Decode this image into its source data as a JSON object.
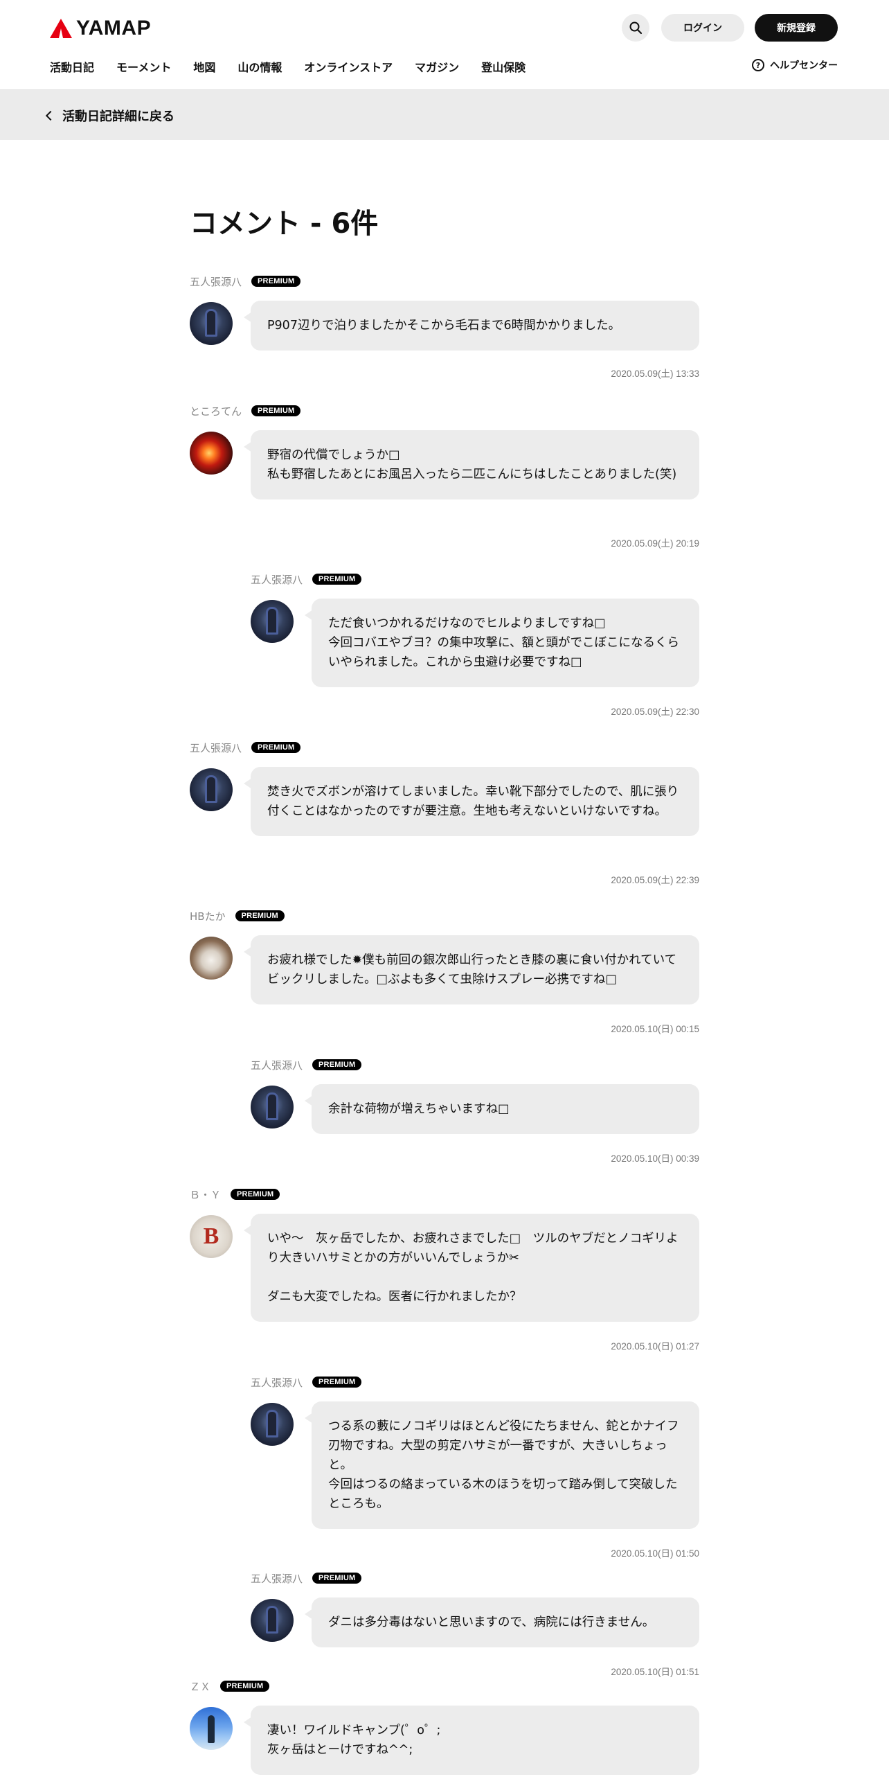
{
  "header": {
    "logo_text": "YAMAP",
    "login_label": "ログイン",
    "signup_label": "新規登録",
    "nav": [
      "活動日記",
      "モーメント",
      "地図",
      "山の情報",
      "オンラインストア",
      "マガジン",
      "登山保険"
    ],
    "help_label": "ヘルプセンター"
  },
  "backbar": {
    "label": "活動日記詳細に戻る"
  },
  "page_title": "コメント - 6件",
  "badge_label": "PREMIUM",
  "comments": [
    {
      "name": "五人張源八",
      "text": "P907辺りで泊りましたかそこから毛石まで6時間かかりました。",
      "date": "2020.05.09(土) 13:33",
      "avatar": "dark"
    },
    {
      "name": "ところてん",
      "text": "野宿の代償でしょうか□\n私も野宿したあとにお風呂入ったら二匹こんにちはしたことありました(笑)",
      "date": "2020.05.09(土) 20:19",
      "avatar": "fire"
    },
    {
      "name": "五人張源八",
      "text": "ただ食いつかれるだけなのでヒルよりましですね□\n今回コバエやブヨ？の集中攻撃に、額と頭がでこぼこになるくらいやられました。これから虫避け必要ですね□",
      "date": "2020.05.09(土) 22:30",
      "avatar": "dark"
    },
    {
      "name": "五人張源八",
      "text": "焚き火でズボンが溶けてしまいました。幸い靴下部分でしたので、肌に張り付くことはなかったのですが要注意。生地も考えないといけないですね。",
      "date": "2020.05.09(土) 22:39",
      "avatar": "dark"
    },
    {
      "name": "HBたか",
      "text": "お疲れ様でした✹僕も前回の銀次郎山行ったとき膝の裏に食い付かれていてビックリしました。□ぶよも多くて虫除けスプレー必携ですね□",
      "date": "2020.05.10(日) 00:15",
      "avatar": "cat"
    },
    {
      "name": "五人張源八",
      "text": "余計な荷物が増えちゃいますね□",
      "date": "2020.05.10(日) 00:39",
      "avatar": "dark"
    },
    {
      "name": "Ｂ・Ｙ",
      "text": "いや〜　灰ヶ岳でしたか、お疲れさまでした□　ツルのヤブだとノコギリより大きいハサミとかの方がいいんでしょうか✂\n\nダニも大変でしたね。医者に行かれましたか？",
      "date": "2020.05.10(日) 01:27",
      "avatar": "b"
    },
    {
      "name": "五人張源八",
      "text": "つる系の藪にノコギリはほとんど役にたちません、鉈とかナイフ刃物ですね。大型の剪定ハサミが一番ですが、大きいしちょっと。\n今回はつるの絡まっている木のほうを切って踏み倒して突破したところも。",
      "date": "2020.05.10(日) 01:50",
      "avatar": "dark"
    },
    {
      "name": "五人張源八",
      "text": "ダニは多分毒はないと思いますので、病院には行きません。",
      "date": "2020.05.10(日) 01:51",
      "avatar": "dark"
    },
    {
      "name": "ＺＸ",
      "text": "凄い！ワイルドキャンプ(゜o゜;\n灰ヶ岳はとーけですね^^;",
      "date": "",
      "avatar": "sky"
    }
  ],
  "avatar_letters": {
    "b": "B"
  },
  "colors": {
    "brand_red": "#e60012",
    "bubble_bg": "#ececec",
    "backbar_bg": "#ebebeb"
  }
}
